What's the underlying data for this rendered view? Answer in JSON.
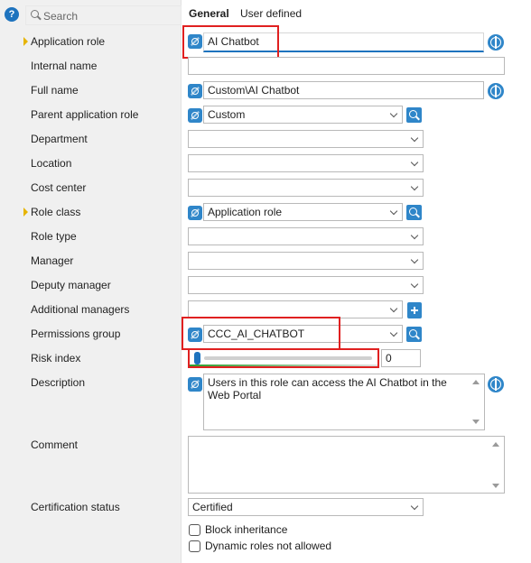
{
  "search": {
    "placeholder": "Search"
  },
  "tabs": [
    {
      "label": "General"
    },
    {
      "label": "User defined"
    }
  ],
  "labels": {
    "application_role": "Application role",
    "internal_name": "Internal name",
    "full_name": "Full name",
    "parent_application_role": "Parent application role",
    "department": "Department",
    "location": "Location",
    "cost_center": "Cost center",
    "role_class": "Role class",
    "role_type": "Role type",
    "manager": "Manager",
    "deputy_manager": "Deputy manager",
    "additional_managers": "Additional managers",
    "permissions_group": "Permissions group",
    "risk_index": "Risk index",
    "description": "Description",
    "comment": "Comment",
    "certification_status": "Certification status"
  },
  "values": {
    "application_role": "AI Chatbot",
    "internal_name": "",
    "full_name": "Custom\\AI Chatbot",
    "parent_application_role": "Custom",
    "department": "",
    "location": "",
    "cost_center": "",
    "role_class": "Application role",
    "role_type": "",
    "manager": "",
    "deputy_manager": "",
    "additional_managers": "",
    "permissions_group": "CCC_AI_CHATBOT",
    "risk_index": "0",
    "risk_index_level": 0,
    "description": "Users in this role can access the AI Chatbot in the Web Portal",
    "comment": "",
    "certification_status": "Certified"
  },
  "checkboxes": {
    "block_inheritance": {
      "label": "Block inheritance",
      "checked": false
    },
    "dynamic_roles_not_allowed": {
      "label": "Dynamic roles not allowed",
      "checked": false
    }
  },
  "colors": {
    "accent": "#1e73be",
    "highlight_box": "#e02020",
    "required_marker": "#e6b400"
  }
}
